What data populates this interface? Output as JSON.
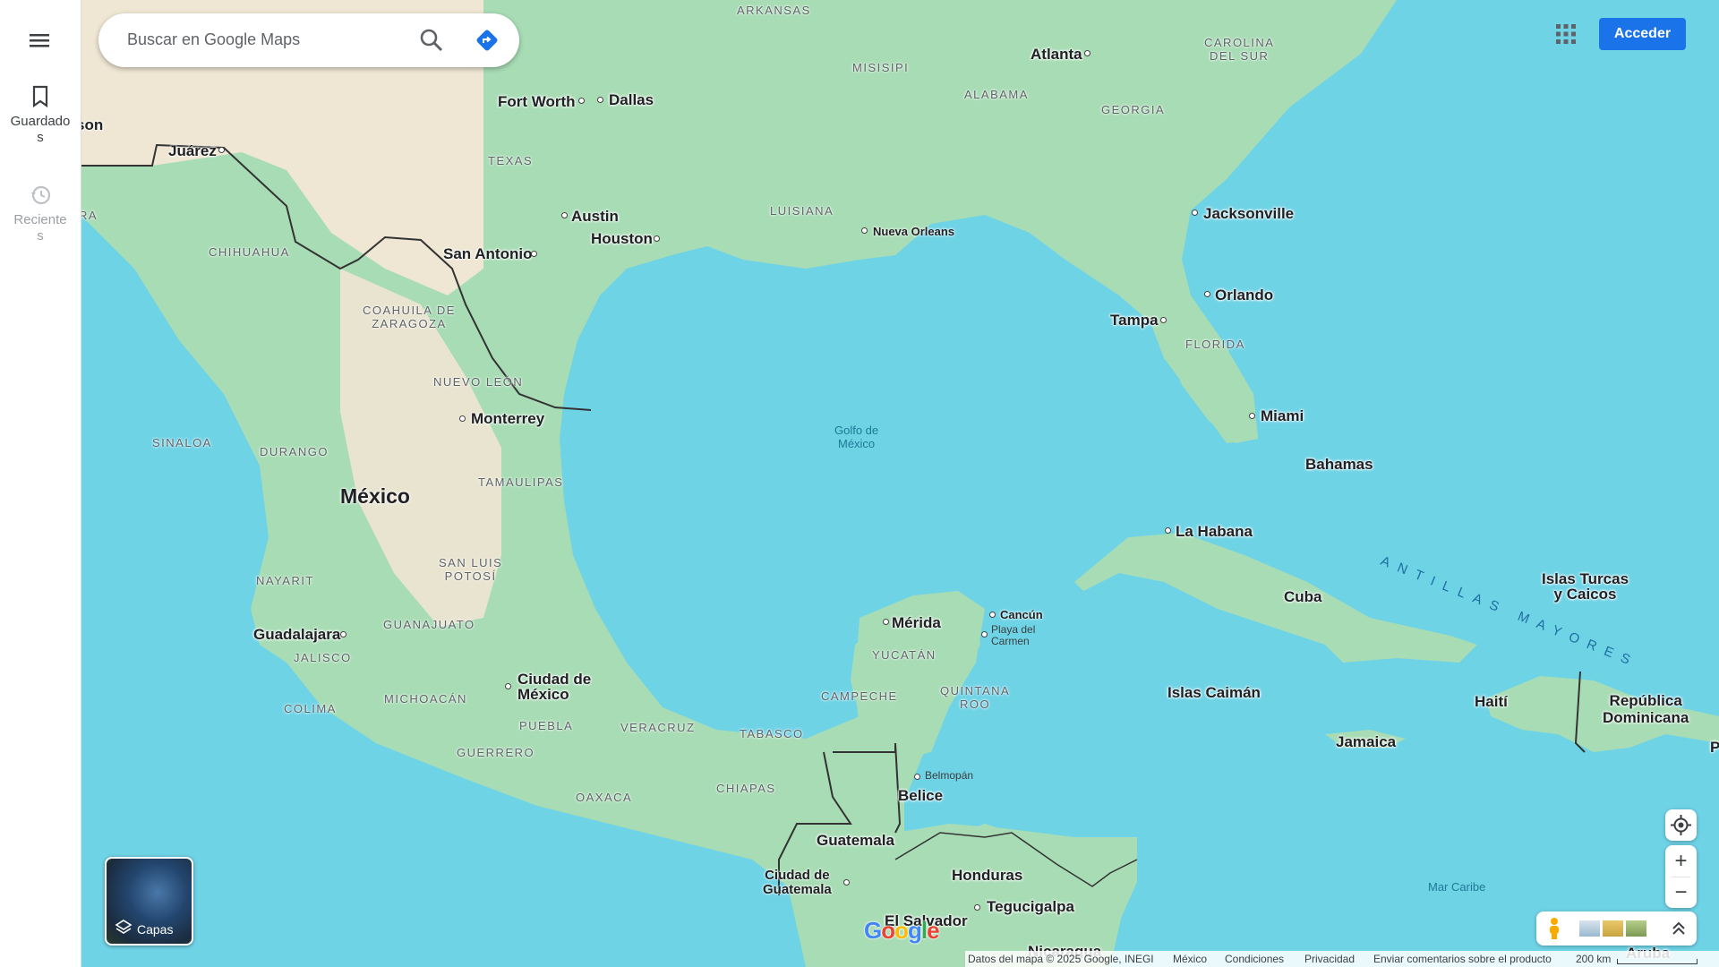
{
  "search": {
    "placeholder": "Buscar en Google Maps"
  },
  "sidebar": {
    "menu_icon": "hamburger-menu-icon",
    "saved_label": "Guardado\ns",
    "recent_label": "Reciente\ns"
  },
  "header": {
    "sign_in_label": "Acceder",
    "apps_icon": "apps-grid-icon"
  },
  "layers": {
    "label": "Capas"
  },
  "map": {
    "labels": {
      "arkansas": "ARKANSAS",
      "misisipi": "MISISIPI",
      "alabama": "ALABAMA",
      "georgia": "GEORGIA",
      "carolina_sur": "CAROLINA\nDEL SUR",
      "texas": "TEXAS",
      "luisiana": "LUISIANA",
      "florida": "FLORIDA",
      "chihuahua": "CHIHUAHUA",
      "coahuila": "COAHUILA DE\nZARAGOZA",
      "nuevo_leon": "NUEVO LEÓN",
      "sinaloa": "SINALOA",
      "durango": "DURANGO",
      "tamaulipas": "TAMAULIPAS",
      "nayarit": "NAYARIT",
      "san_luis": "SAN LUIS\nPOTOSÍ",
      "guanajuato": "GUANAJUATO",
      "jalisco": "JALISCO",
      "michoacan": "MICHOACÁN",
      "colima": "COLIMA",
      "puebla": "PUEBLA",
      "guerrero": "GUERRERO",
      "veracruz": "VERACRUZ",
      "oaxaca": "OAXACA",
      "tabasco": "TABASCO",
      "chiapas": "CHIAPAS",
      "campeche": "CAMPECHE",
      "yucatan": "YUCATÁN",
      "quintana_roo": "QUINTANA\nROO",
      "ara": "RA",
      "atlanta": "Atlanta",
      "fort_worth": "Fort Worth",
      "dallas": "Dallas",
      "juarez": "Juárez",
      "son": "son",
      "austin": "Austin",
      "houston": "Houston",
      "san_antonio": "San Antonio",
      "nueva_orleans": "Nueva Orleans",
      "jacksonville": "Jacksonville",
      "orlando": "Orlando",
      "tampa": "Tampa",
      "miami": "Miami",
      "monterrey": "Monterrey",
      "mexico": "México",
      "guadalajara": "Guadalajara",
      "cdmx": "Ciudad de\nMéxico",
      "merida": "Mérida",
      "cancun": "Cancún",
      "playa_del_carmen": "Playa del\nCarmen",
      "belmopan": "Belmopán",
      "belice": "Belice",
      "guatemala": "Guatemala",
      "ciudad_guatemala": "Ciudad de\nGuatemala",
      "honduras": "Honduras",
      "tegucigalpa": "Tegucigalpa",
      "el_salvador": "El Salvador",
      "nicaragua": "Nicaragua",
      "bahamas": "Bahamas",
      "la_habana": "La Habana",
      "cuba": "Cuba",
      "islas_caiman": "Islas Caimán",
      "jamaica": "Jamaica",
      "haiti": "Haití",
      "rep_dom": "República\nDominicana",
      "turcas": "Islas Turcas\ny Caicos",
      "aruba": "Aruba",
      "p": "P",
      "golfo": "Golfo de\nMéxico",
      "mar_caribe": "Mar Caribe",
      "antillas": "ANTILLAS MAYORES"
    }
  },
  "controls": {
    "location_icon": "my-location-icon",
    "zoom_in": "+",
    "zoom_out": "−",
    "pegman_icon": "pegman-icon"
  },
  "footer": {
    "data": "Datos del mapa © 2025 Google, INEGI",
    "country": "México",
    "terms": "Condiciones",
    "privacy": "Privacidad",
    "feedback": "Enviar comentarios sobre el producto",
    "scale": "200 km"
  },
  "logo": "Google"
}
